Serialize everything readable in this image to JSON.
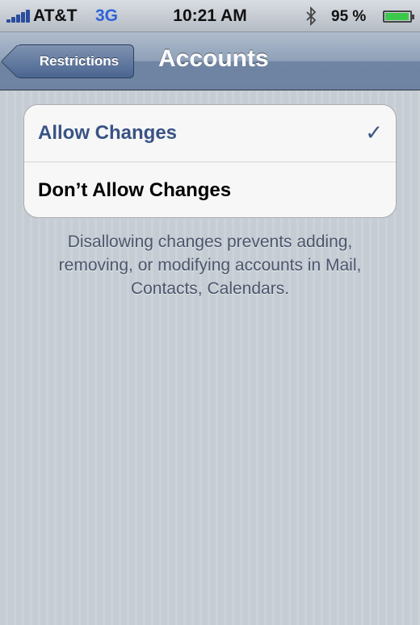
{
  "status_bar": {
    "carrier": "AT&T",
    "network": "3G",
    "time": "10:21 AM",
    "battery_percent": "95 %",
    "battery_level": 0.95,
    "icons": [
      "signal-icon",
      "bluetooth-icon",
      "battery-icon"
    ]
  },
  "nav": {
    "back_label": "Restrictions",
    "title": "Accounts"
  },
  "options": [
    {
      "label": "Allow Changes",
      "selected": true
    },
    {
      "label": "Don’t Allow Changes",
      "selected": false
    }
  ],
  "checkmark": "✓",
  "footer": "Disallowing changes prevents adding, removing, or modifying accounts in Mail, Contacts, Calendars.",
  "colors": {
    "selected_text": "#395385",
    "network_accent": "#2f63d9",
    "battery": "#3cc84a"
  }
}
